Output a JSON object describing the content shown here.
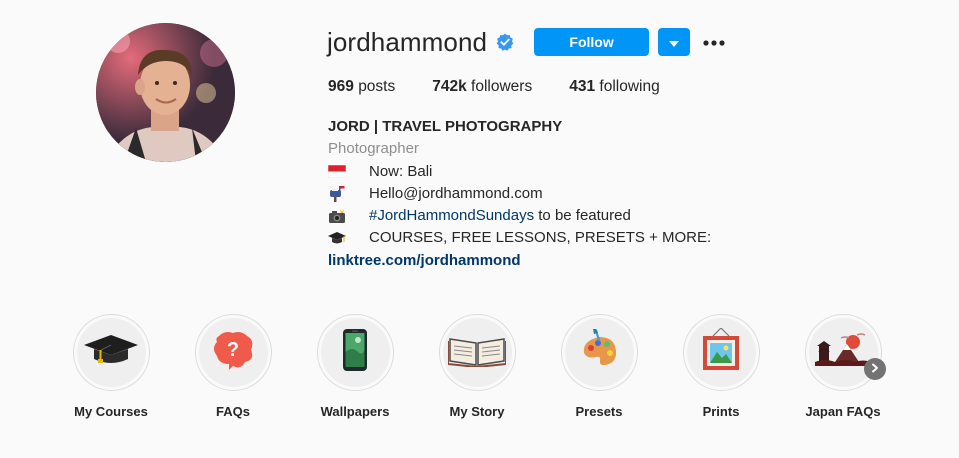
{
  "profile": {
    "username": "jordhammond",
    "follow_label": "Follow",
    "stats": {
      "posts_count": "969",
      "posts_label": "posts",
      "followers_count": "742k",
      "followers_label": "followers",
      "following_count": "431",
      "following_label": "following"
    },
    "bio": {
      "name": "JORD | TRAVEL PHOTOGRAPHY",
      "category": "Photographer",
      "line_location": "Now: Bali",
      "line_email": "Hello@jordhammond.com",
      "line_hashtag": "#JordHammondSundays",
      "line_hashtag_suffix": " to be featured",
      "line_courses": "COURSES, FREE LESSONS, PRESETS + MORE:",
      "link": "linktree.com/jordhammond"
    },
    "icons": {
      "verified": "verified-badge-icon",
      "dropdown": "chevron-down-icon",
      "more": "more-options-icon"
    }
  },
  "highlights": [
    {
      "label": "My Courses",
      "icon": "graduation-cap-icon"
    },
    {
      "label": "FAQs",
      "icon": "question-bubble-icon"
    },
    {
      "label": "Wallpapers",
      "icon": "phone-icon"
    },
    {
      "label": "My Story",
      "icon": "open-book-icon"
    },
    {
      "label": "Presets",
      "icon": "paint-palette-icon"
    },
    {
      "label": "Prints",
      "icon": "framed-picture-icon"
    },
    {
      "label": "Japan FAQs",
      "icon": "japan-scene-icon"
    }
  ],
  "colors": {
    "accent": "#0095f6",
    "link": "#00376b",
    "text": "#262626",
    "muted": "#8e8e8e",
    "background": "#fafafa"
  }
}
